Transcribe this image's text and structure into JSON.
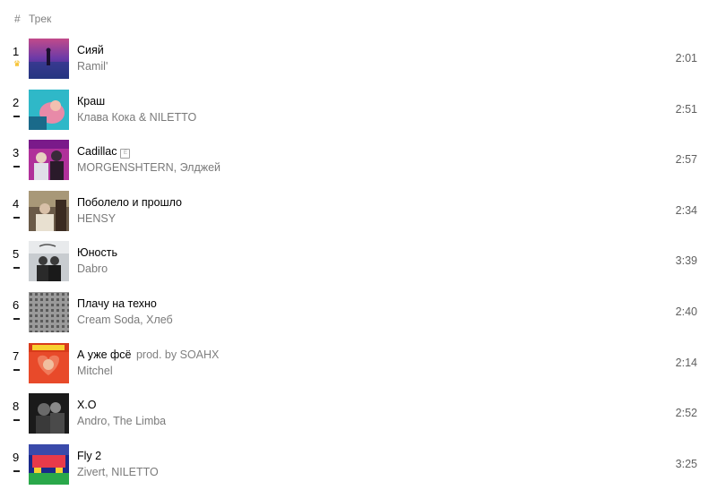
{
  "header": {
    "hash": "#",
    "track_label": "Трек"
  },
  "tracks": [
    {
      "position": "1",
      "trend": "crown",
      "title": "Сияй",
      "suffix": "",
      "explicit": false,
      "artist": "Ramil'",
      "duration": "2:01"
    },
    {
      "position": "2",
      "trend": "same",
      "title": "Краш",
      "suffix": "",
      "explicit": false,
      "artist": "Клава Кока & NILETTO",
      "duration": "2:51"
    },
    {
      "position": "3",
      "trend": "same",
      "title": "Cadillac",
      "suffix": "",
      "explicit": true,
      "explicit_mark": "E",
      "artist": "MORGENSHTERN, Элджей",
      "duration": "2:57"
    },
    {
      "position": "4",
      "trend": "same",
      "title": "Поболело и прошло",
      "suffix": "",
      "explicit": false,
      "artist": "HENSY",
      "duration": "2:34"
    },
    {
      "position": "5",
      "trend": "same",
      "title": "Юность",
      "suffix": "",
      "explicit": false,
      "artist": "Dabro",
      "duration": "3:39"
    },
    {
      "position": "6",
      "trend": "same",
      "title": "Плачу на техно",
      "suffix": "",
      "explicit": false,
      "artist": "Cream Soda, Хлеб",
      "duration": "2:40"
    },
    {
      "position": "7",
      "trend": "same",
      "title": "А уже фсё",
      "suffix": "prod. by SOAHX",
      "explicit": false,
      "artist": "Mitchel",
      "duration": "2:14"
    },
    {
      "position": "8",
      "trend": "same",
      "title": "X.O",
      "suffix": "",
      "explicit": false,
      "artist": "Andro, The Limba",
      "duration": "2:52"
    },
    {
      "position": "9",
      "trend": "same",
      "title": "Fly 2",
      "suffix": "",
      "explicit": false,
      "artist": "Zivert, NILETTO",
      "duration": "3:25"
    }
  ],
  "colors": {
    "crown": "#f5b400",
    "secondary_text": "#7a7a7a"
  }
}
